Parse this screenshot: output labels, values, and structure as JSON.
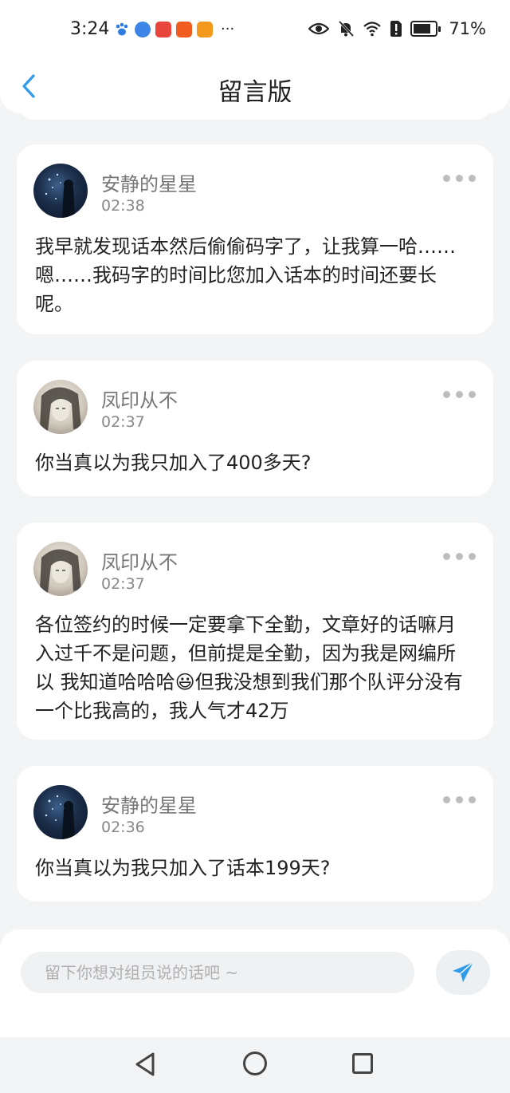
{
  "status_bar": {
    "time": "3:24",
    "more_dots": "···",
    "battery": "71%"
  },
  "header": {
    "title": "留言版"
  },
  "messages": [
    {
      "username": "安静的星星",
      "time": "02:38",
      "text": "我早就发现话本然后偷偷码字了，让我算一哈……嗯……我码字的时间比您加入话本的时间还要长呢。",
      "avatar": "starry-avatar"
    },
    {
      "username": "凤印从不",
      "time": "02:37",
      "text": "你当真以为我只加入了400多天?",
      "avatar": "sketch-avatar"
    },
    {
      "username": "凤印从不",
      "time": "02:37",
      "text_before": "各位签约的时候一定要拿下全勤，文章好的话嘛月入过千不是问题，但前提是全勤，因为我是网编所以 我知道哈哈哈",
      "emoji": "😃",
      "text_after": "但我没想到我们那个队评分没有一个比我高的，我人气才42万",
      "avatar": "sketch-avatar"
    },
    {
      "username": "安静的星星",
      "time": "02:36",
      "text": "你当真以为我只加入了话本199天?",
      "avatar": "starry-avatar"
    }
  ],
  "composer": {
    "placeholder": "留下你想对组员说的话吧 ~"
  },
  "colors": {
    "accent": "#2f9bea",
    "background": "#f3f4f6"
  }
}
